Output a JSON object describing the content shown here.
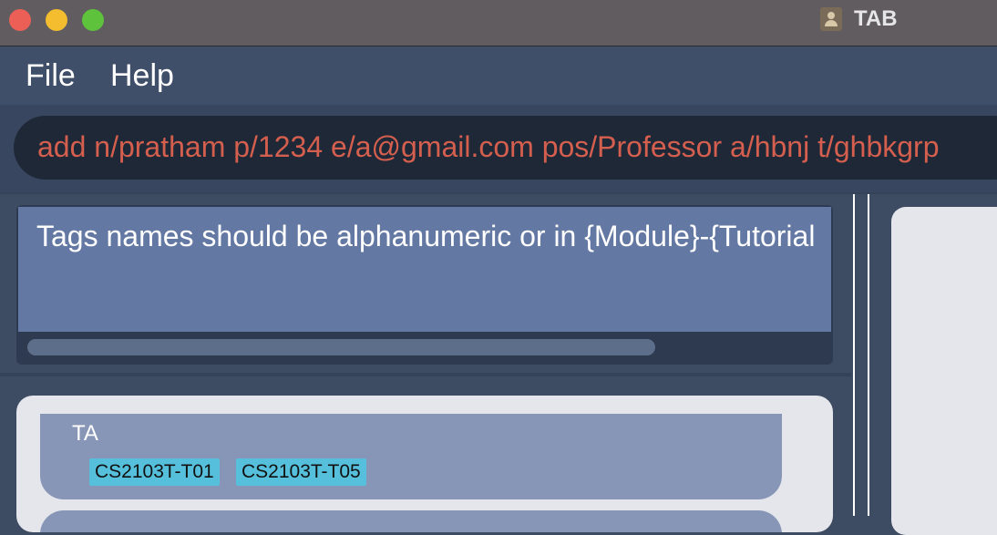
{
  "window": {
    "title": "TAB",
    "app_icon": "contacts-icon"
  },
  "menu": {
    "file_label": "File",
    "help_label": "Help"
  },
  "command": {
    "text": "add n/pratham p/1234 e/a@gmail.com pos/Professor a/hbnj t/ghbkgrp"
  },
  "result": {
    "message": "Tags names should be alphanumeric or in {Module}-{Tutorial"
  },
  "person_list": {
    "items": [
      {
        "name": "TA",
        "tags": [
          "CS2103T-T01",
          "CS2103T-T05"
        ]
      }
    ]
  },
  "colors": {
    "command_text": "#d55f4e",
    "tag_background": "#56c0dc",
    "result_background": "#6378a3",
    "card_background": "#8795b7"
  }
}
